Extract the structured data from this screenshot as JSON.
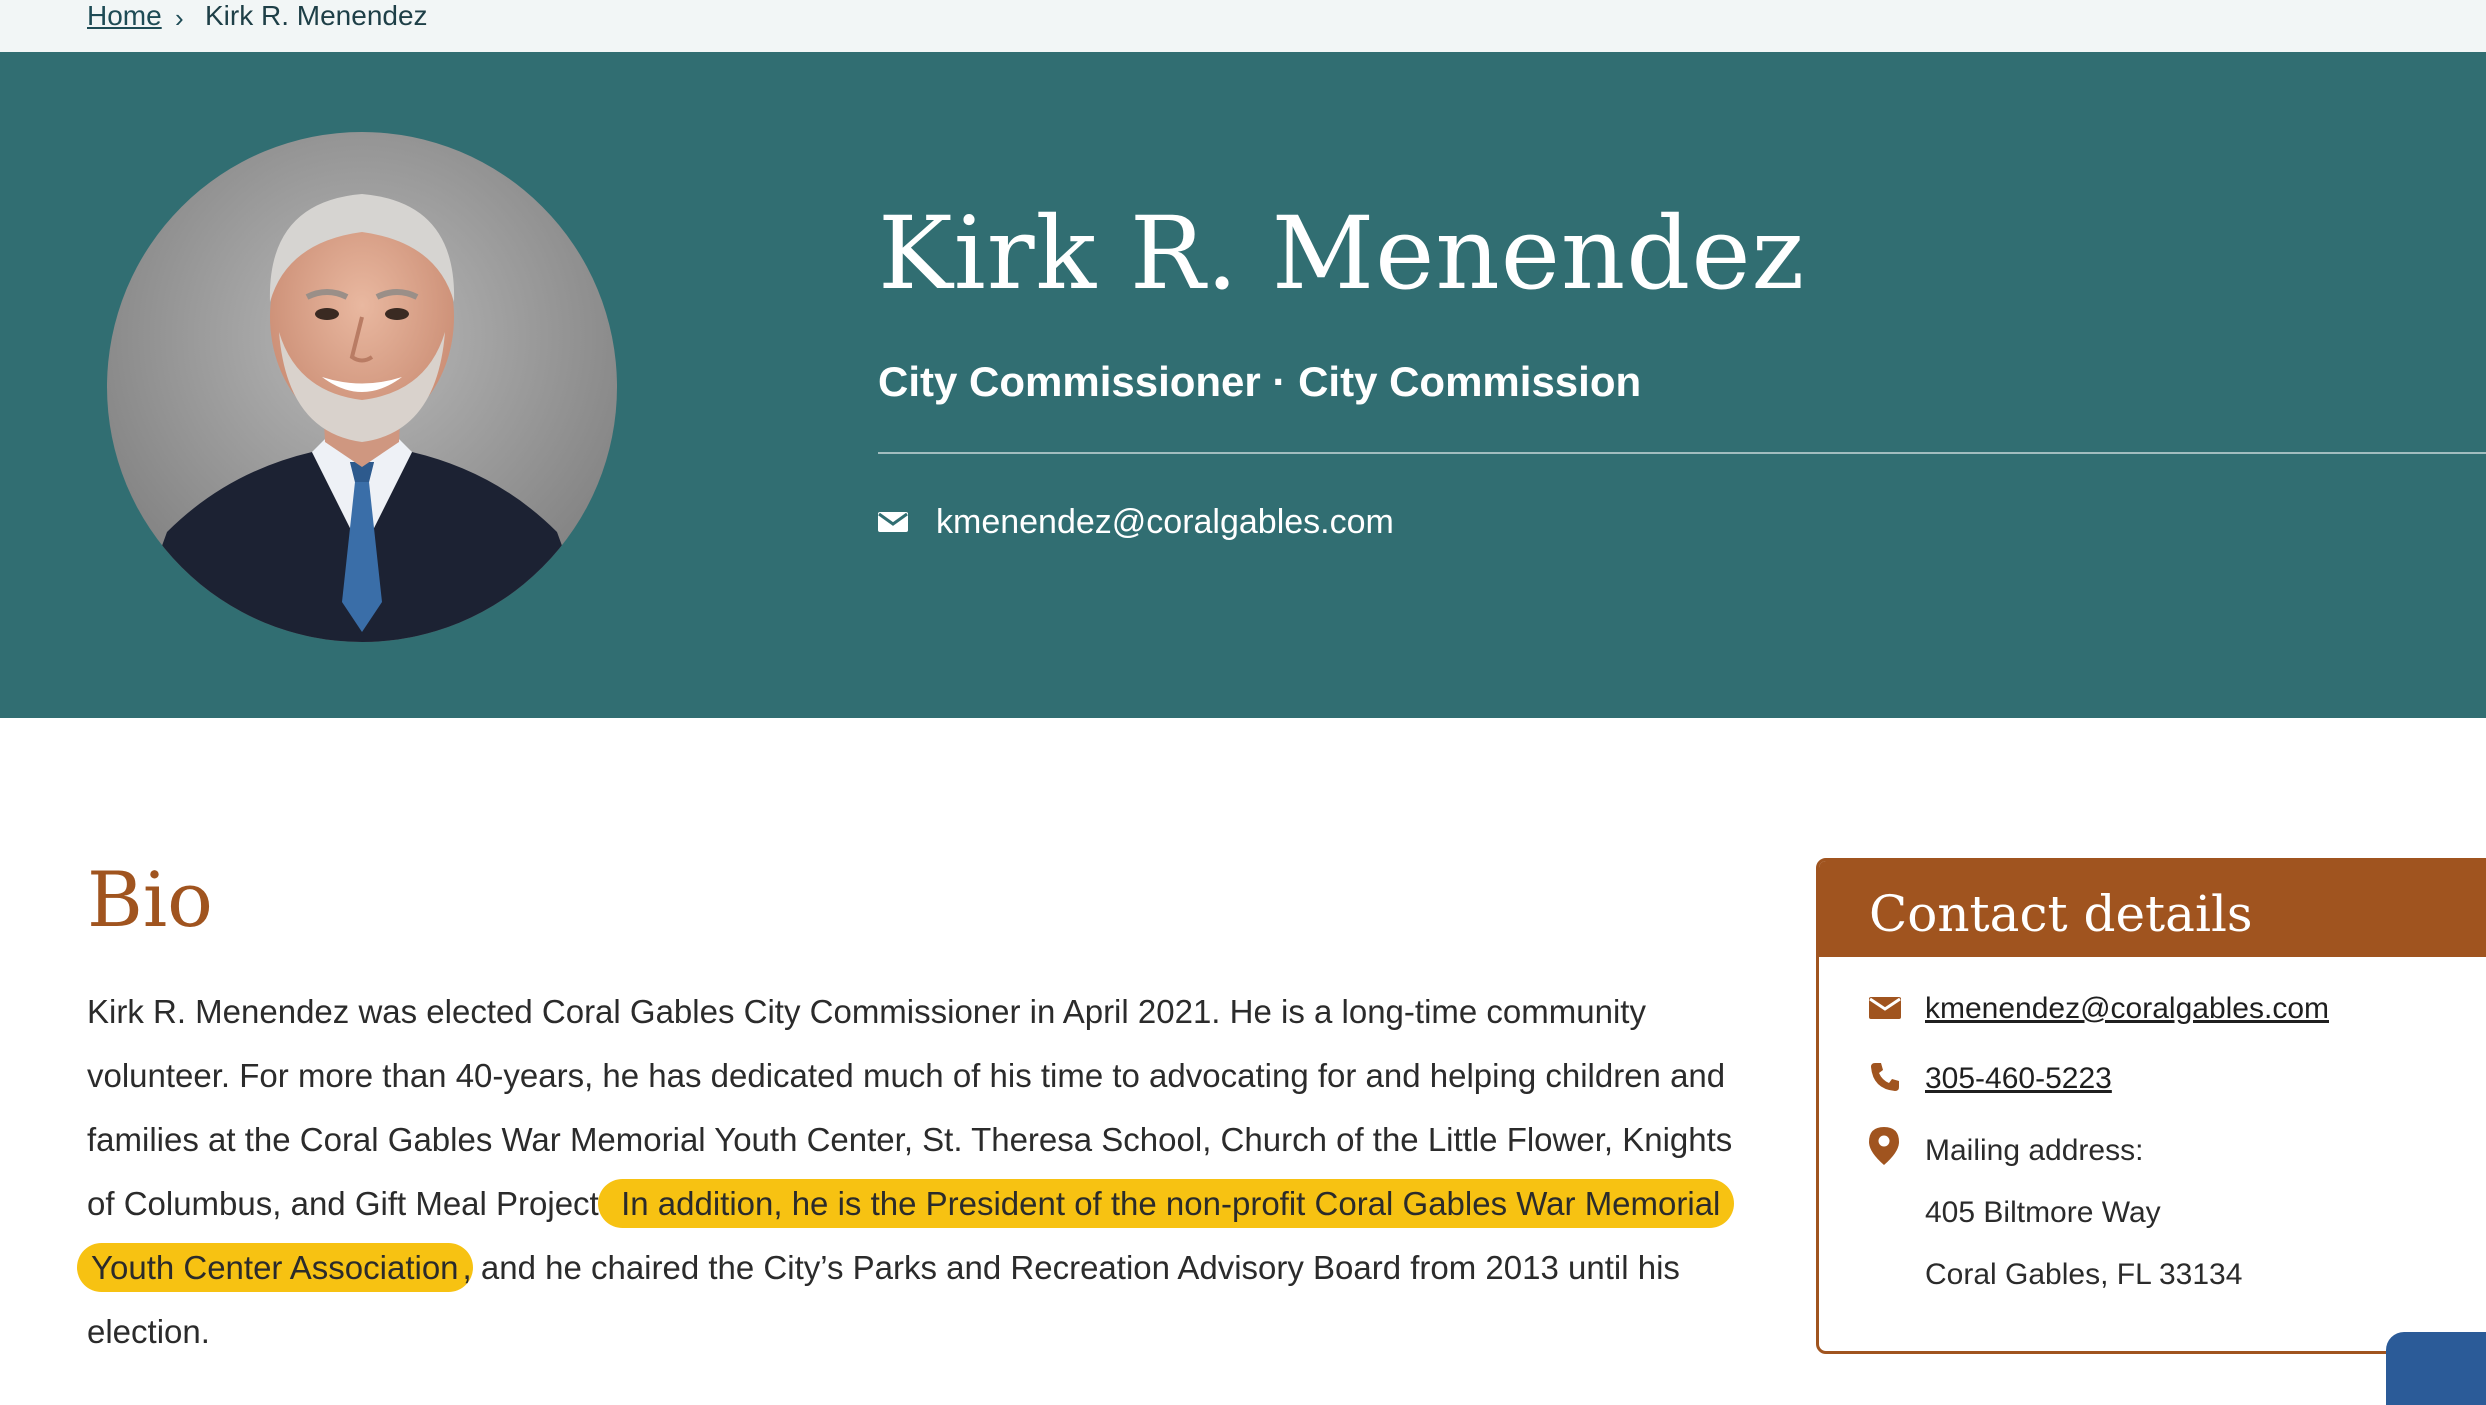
{
  "breadcrumb": {
    "home": "Home",
    "separator": "›",
    "current": "Kirk R. Menendez"
  },
  "hero": {
    "name": "Kirk R. Menendez",
    "role": "City Commissioner · City Commission",
    "email": "kmenendez@coralgables.com",
    "photo_alt": "Portrait of Kirk R. Menendez"
  },
  "bio": {
    "title": "Bio",
    "text_before": "Kirk R. Menendez was elected Coral Gables City Commissioner in April 2021. He is a long-time community volunteer. For more than 40-years, he has dedicated much of his time to advocating for and helping children and families at the Coral Gables War Memorial Youth Center, St. Theresa School, Church of the Little Flower, Knights of Columbus, and Gift Meal Project.",
    "text_highlight": " In addition, he is the President of the non-profit Coral Gables War Memorial Youth Center Association",
    "text_after": ", and he chaired the City’s Parks and Recreation Advisory Board from 2013 until his election."
  },
  "contact": {
    "title": "Contact details",
    "email": "kmenendez@coralgables.com",
    "phone": "305-460-5223",
    "mailing_label": "Mailing address:",
    "address_line1": "405 Biltmore Way",
    "address_line2": "Coral Gables, FL 33134"
  },
  "colors": {
    "hero_bg": "#316e72",
    "accent": "#a0541f",
    "highlight": "#f7c212"
  },
  "icons": {
    "hero_email": "envelope-icon",
    "contact_email": "envelope-icon",
    "contact_phone": "phone-icon",
    "contact_address": "map-pin-icon"
  }
}
